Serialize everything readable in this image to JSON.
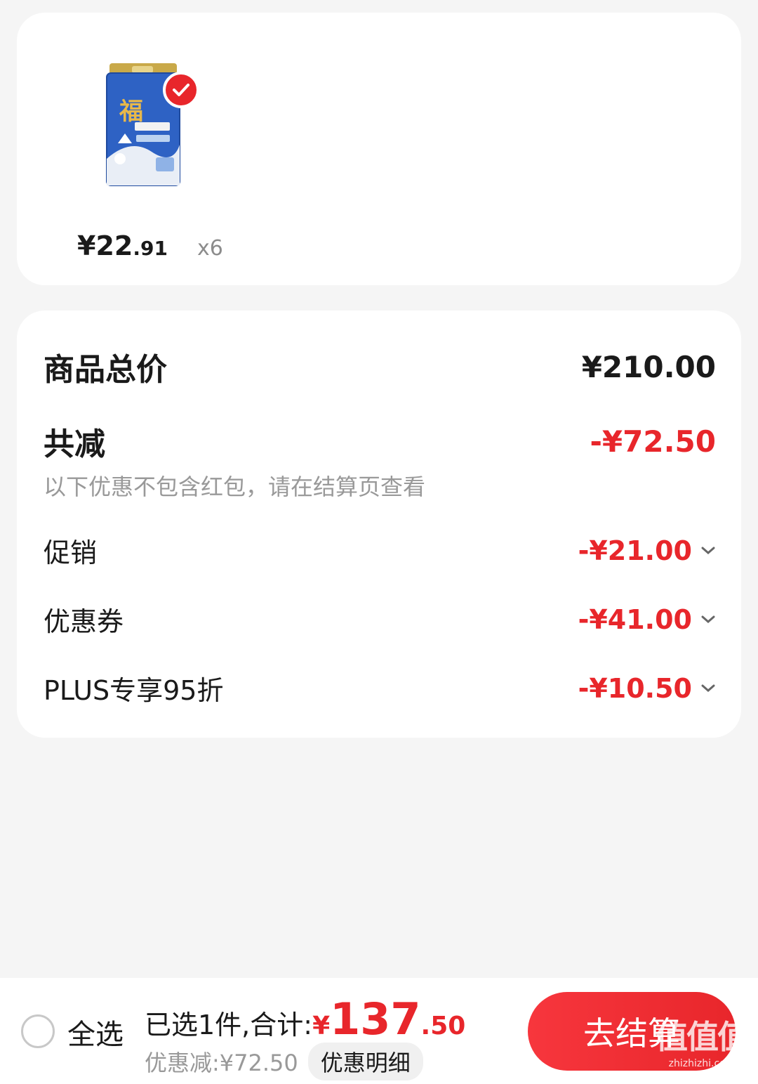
{
  "product": {
    "price_main": "¥22",
    "price_decimal": ".91",
    "quantity": "x6",
    "selected": true
  },
  "summary": {
    "total_label": "商品总价",
    "total_value": "¥210.00",
    "reduction_label": "共减",
    "reduction_value": "-¥72.50",
    "note": "以下优惠不包含红包，请在结算页查看",
    "items": [
      {
        "label": "促销",
        "value": "-¥21.00"
      },
      {
        "label": "优惠券",
        "value": "-¥41.00"
      },
      {
        "label": "PLUS专享95折",
        "value": "-¥10.50"
      }
    ]
  },
  "bottom_bar": {
    "select_all": "全选",
    "selected_total_label": "已选1件,合计:",
    "total_yen": "¥",
    "total_integer": "137",
    "total_decimal": ".50",
    "discount_text": "优惠减:¥72.50",
    "detail_button": "优惠明细",
    "checkout_button": "去结算"
  },
  "watermark": {
    "logo": "值值值",
    "site": "zhizhizhi.com"
  },
  "colors": {
    "accent_red": "#e8262b",
    "background": "#f5f5f5"
  }
}
